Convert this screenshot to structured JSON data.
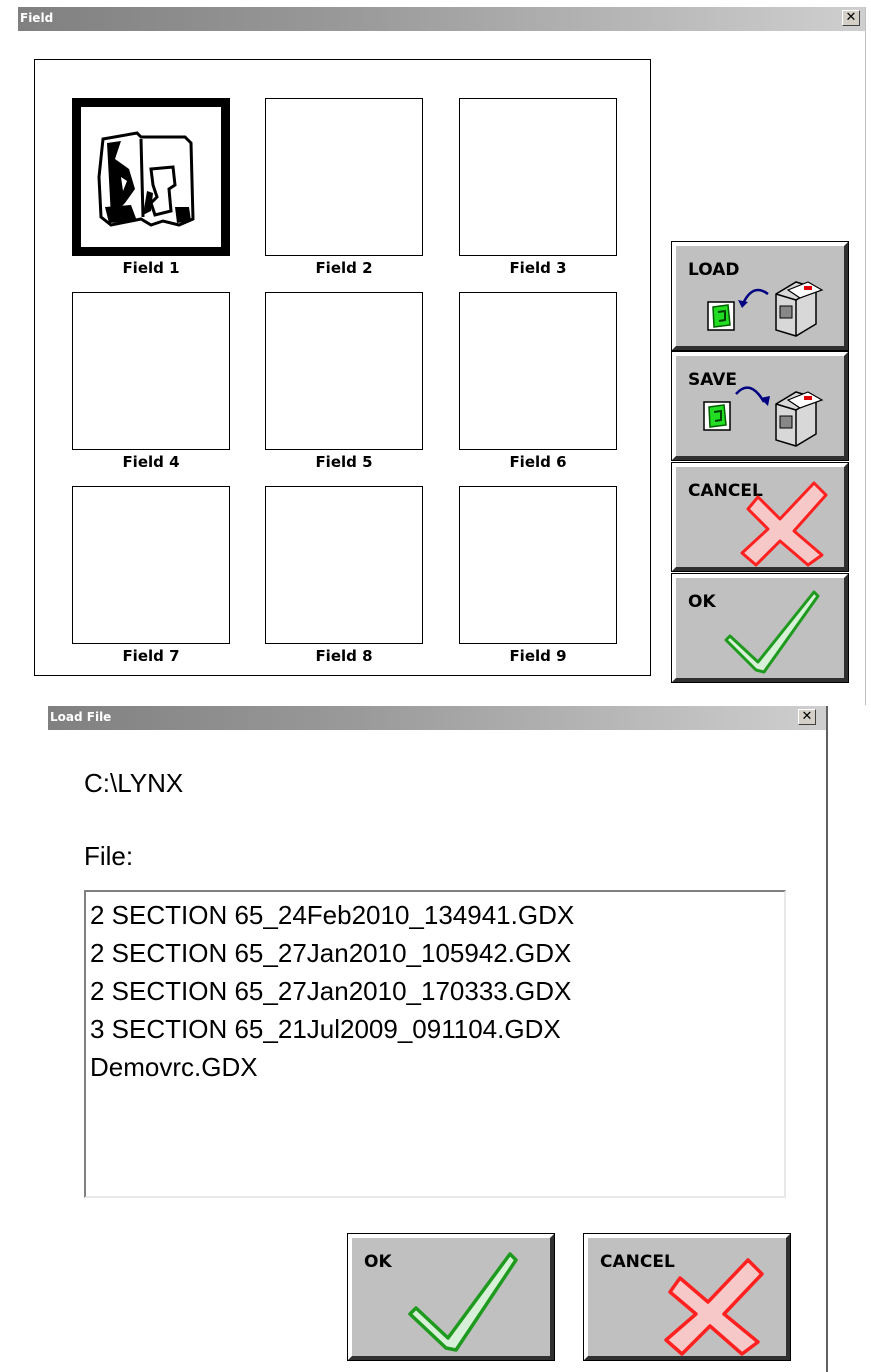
{
  "field_window": {
    "title": "Field",
    "close_glyph": "✕",
    "fields": [
      {
        "label": "Field 1",
        "selected": true
      },
      {
        "label": "Field 2",
        "selected": false
      },
      {
        "label": "Field 3",
        "selected": false
      },
      {
        "label": "Field 4",
        "selected": false
      },
      {
        "label": "Field 5",
        "selected": false
      },
      {
        "label": "Field 6",
        "selected": false
      },
      {
        "label": "Field 7",
        "selected": false
      },
      {
        "label": "Field 8",
        "selected": false
      },
      {
        "label": "Field 9",
        "selected": false
      }
    ],
    "buttons": {
      "load": "LOAD",
      "save": "SAVE",
      "cancel": "CANCEL",
      "ok": "OK"
    }
  },
  "load_window": {
    "title": "Load File",
    "close_glyph": "✕",
    "path": "C:\\LYNX",
    "file_label": "File:",
    "files": [
      "2 SECTION 65_24Feb2010_134941.GDX",
      "2 SECTION 65_27Jan2010_105942.GDX",
      "2 SECTION 65_27Jan2010_170333.GDX",
      "3 SECTION 65_21Jul2009_091104.GDX",
      "Demovrc.GDX"
    ],
    "buttons": {
      "ok": "OK",
      "cancel": "CANCEL"
    }
  },
  "icons": {
    "field_icon": "green-field-icon",
    "disk_icon": "floppy-drive-icon",
    "check_icon": "green-check-icon",
    "cross_icon": "red-x-icon"
  },
  "colors": {
    "check_green": "#1e9a1e",
    "cross_red": "#ff2020",
    "field_green": "#22dd22",
    "arrow_blue": "#000080",
    "button_face": "#c0c0c0"
  }
}
